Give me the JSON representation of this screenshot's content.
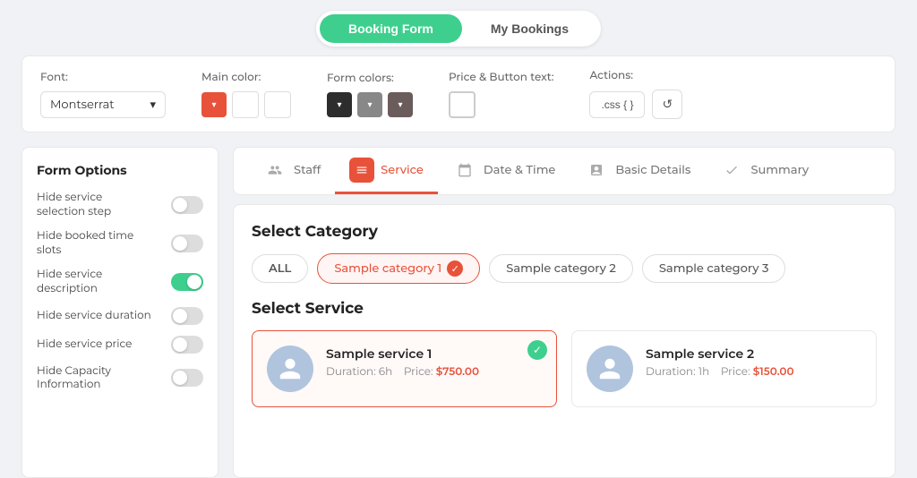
{
  "topNav": {
    "tabs": [
      {
        "id": "booking-form",
        "label": "Booking Form",
        "active": true
      },
      {
        "id": "my-bookings",
        "label": "My Bookings",
        "active": false
      }
    ]
  },
  "toolbar": {
    "fontLabel": "Font:",
    "fontValue": "Montserrat",
    "mainColorLabel": "Main color:",
    "formColorsLabel": "Form colors:",
    "priceButtonLabel": "Price & Button text:",
    "actionsLabel": "Actions:",
    "cssBtnLabel": ".css { }",
    "refreshIcon": "↺"
  },
  "sidebar": {
    "title": "Form Options",
    "options": [
      {
        "id": "hide-service-selection",
        "label": "Hide service selection step",
        "on": false
      },
      {
        "id": "hide-booked-time",
        "label": "Hide booked time slots",
        "on": false
      },
      {
        "id": "hide-service-description",
        "label": "Hide service description",
        "on": true
      },
      {
        "id": "hide-service-duration",
        "label": "Hide service duration",
        "on": false
      },
      {
        "id": "hide-service-price",
        "label": "Hide service price",
        "on": false
      },
      {
        "id": "hide-capacity-info",
        "label": "Hide Capacity Information",
        "on": false
      }
    ]
  },
  "steps": [
    {
      "id": "staff",
      "label": "Staff",
      "icon": "👥",
      "active": false
    },
    {
      "id": "service",
      "label": "Service",
      "icon": "☰",
      "active": true
    },
    {
      "id": "date-time",
      "label": "Date & Time",
      "icon": "📅",
      "active": false
    },
    {
      "id": "basic-details",
      "label": "Basic Details",
      "icon": "📋",
      "active": false
    },
    {
      "id": "summary",
      "label": "Summary",
      "icon": "✔",
      "active": false
    }
  ],
  "formContent": {
    "selectCategoryTitle": "Select Category",
    "categories": [
      {
        "id": "all",
        "label": "ALL",
        "active": false
      },
      {
        "id": "cat1",
        "label": "Sample category 1",
        "active": true
      },
      {
        "id": "cat2",
        "label": "Sample category 2",
        "active": false
      },
      {
        "id": "cat3",
        "label": "Sample category 3",
        "active": false
      }
    ],
    "selectServiceTitle": "Select Service",
    "services": [
      {
        "id": "service1",
        "name": "Sample service 1",
        "durationLabel": "Duration: 6h",
        "priceLabel": "Price:",
        "price": "$750.00",
        "selected": true
      },
      {
        "id": "service2",
        "name": "Sample service 2",
        "durationLabel": "Duration: 1h",
        "priceLabel": "Price:",
        "price": "$150.00",
        "selected": false
      }
    ]
  }
}
